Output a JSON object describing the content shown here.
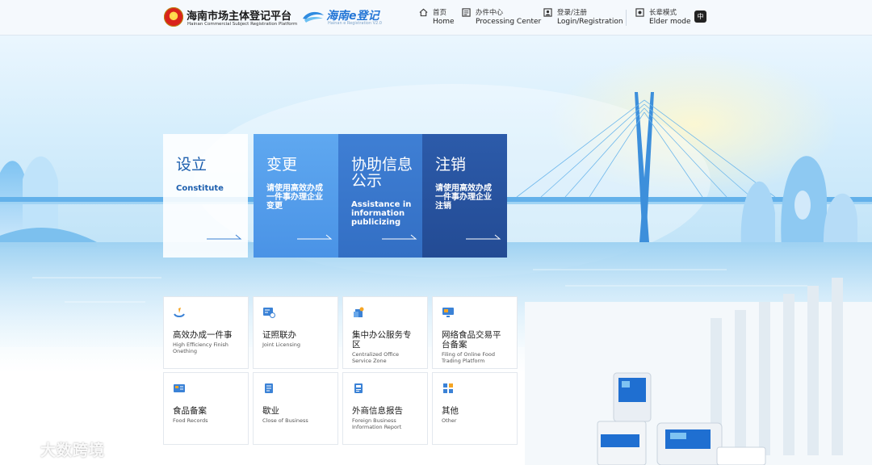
{
  "header": {
    "site_title": "海南市场主体登记平台",
    "site_subtitle": "Hainan Commercial Subject Registration Platform",
    "e_title": "海南e登记",
    "e_subtitle": "Hainan e Registration V2.0",
    "nav": [
      {
        "zh": "首页",
        "en": "Home",
        "icon": "home-icon"
      },
      {
        "zh": "办件中心",
        "en": "Processing Center",
        "icon": "document-icon"
      },
      {
        "zh": "登录/注册",
        "en": "Login/Registration",
        "icon": "user-card-icon"
      },
      {
        "zh": "长辈模式",
        "en": "Elder mode",
        "icon": "elder-mode-icon"
      }
    ],
    "lang_label": "中"
  },
  "tiles": [
    {
      "title": "设立",
      "subtitle": "Constitute"
    },
    {
      "title": "变更",
      "subtitle": "请使用高效办成一件事办理企业变更"
    },
    {
      "title": "协助信息公示",
      "subtitle": "Assistance in information publicizing"
    },
    {
      "title": "注销",
      "subtitle": "请使用高效办成一件事办理企业注销"
    }
  ],
  "cards": [
    {
      "zh": "高效办成一件事",
      "en": "High Efficiency Finish Onething",
      "icon": "one-thing-icon"
    },
    {
      "zh": "证照联办",
      "en": "Joint Licensing",
      "icon": "license-icon"
    },
    {
      "zh": "集中办公服务专区",
      "en": "Centralized Office Service Zone",
      "icon": "office-zone-icon"
    },
    {
      "zh": "网络食品交易平台备案",
      "en": "Filing of Online Food Trading Platform",
      "icon": "monitor-icon"
    },
    {
      "zh": "食品备案",
      "en": "Food Records",
      "icon": "food-record-icon"
    },
    {
      "zh": "歇业",
      "en": "Close of Business",
      "icon": "close-business-icon"
    },
    {
      "zh": "外商信息报告",
      "en": "Foreign Business Information Report",
      "icon": "foreign-report-icon"
    },
    {
      "zh": "其他",
      "en": "Other",
      "icon": "grid-icon"
    }
  ],
  "watermark": "大数跨境",
  "colors": {
    "primary": "#2476d6",
    "tile_light": "#ffffff",
    "tile_mid": "#4a93e6",
    "tile_dark": "#336fc4",
    "tile_darkest": "#234b94",
    "icon_blue": "#3b82d6",
    "icon_orange": "#f5a524"
  }
}
